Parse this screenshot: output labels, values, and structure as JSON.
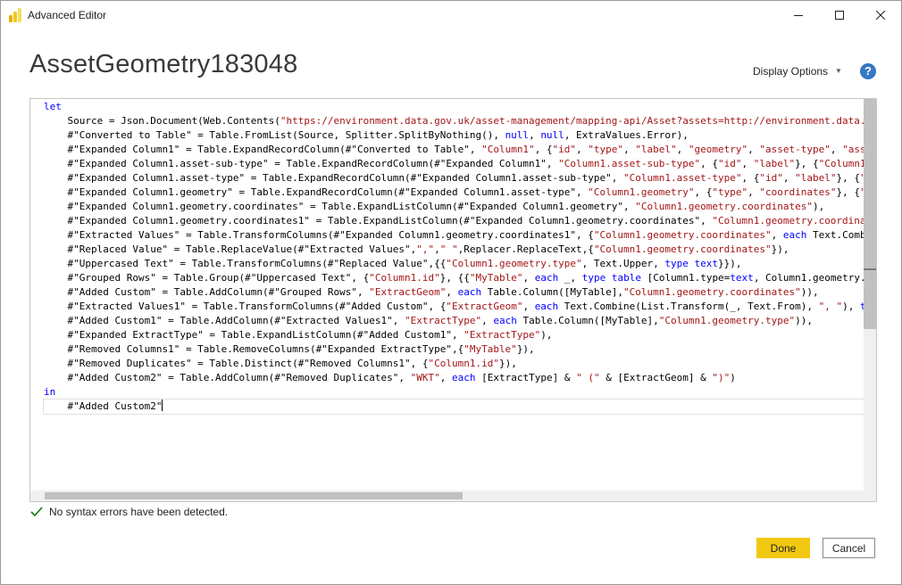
{
  "window": {
    "title": "Advanced Editor",
    "minimize_label": "minimize",
    "maximize_label": "maximize",
    "close_label": "close"
  },
  "header": {
    "query_name": "AssetGeometry183048",
    "display_options_label": "Display Options",
    "help_label": "?"
  },
  "editor": {
    "lines": [
      [
        {
          "t": "let",
          "c": "kw"
        }
      ],
      [
        {
          "t": "    Source = Json.Document(Web.Contents("
        },
        {
          "t": "\"https://environment.data.gov.uk/asset-management/mapping-api/Asset?assets=http://environment.data.gov",
          "c": "str"
        }
      ],
      [
        {
          "t": "    #\"Converted to Table\" = Table.FromList(Source, Splitter.SplitByNothing(), "
        },
        {
          "t": "null",
          "c": "kw"
        },
        {
          "t": ", "
        },
        {
          "t": "null",
          "c": "kw"
        },
        {
          "t": ", ExtraValues.Error),"
        }
      ],
      [
        {
          "t": "    #\"Expanded Column1\" = Table.ExpandRecordColumn(#\"Converted to Table\", "
        },
        {
          "t": "\"Column1\"",
          "c": "str"
        },
        {
          "t": ", {"
        },
        {
          "t": "\"id\"",
          "c": "str"
        },
        {
          "t": ", "
        },
        {
          "t": "\"type\"",
          "c": "str"
        },
        {
          "t": ", "
        },
        {
          "t": "\"label\"",
          "c": "str"
        },
        {
          "t": ", "
        },
        {
          "t": "\"geometry\"",
          "c": "str"
        },
        {
          "t": ", "
        },
        {
          "t": "\"asset-type\"",
          "c": "str"
        },
        {
          "t": ", "
        },
        {
          "t": "\"asset",
          "c": "str"
        }
      ],
      [
        {
          "t": "    #\"Expanded Column1.asset-sub-type\" = Table.ExpandRecordColumn(#\"Expanded Column1\", "
        },
        {
          "t": "\"Column1.asset-sub-type\"",
          "c": "str"
        },
        {
          "t": ", {"
        },
        {
          "t": "\"id\"",
          "c": "str"
        },
        {
          "t": ", "
        },
        {
          "t": "\"label\"",
          "c": "str"
        },
        {
          "t": "}, {"
        },
        {
          "t": "\"Column1.as",
          "c": "str"
        }
      ],
      [
        {
          "t": "    #\"Expanded Column1.asset-type\" = Table.ExpandRecordColumn(#\"Expanded Column1.asset-sub-type\", "
        },
        {
          "t": "\"Column1.asset-type\"",
          "c": "str"
        },
        {
          "t": ", {"
        },
        {
          "t": "\"id\"",
          "c": "str"
        },
        {
          "t": ", "
        },
        {
          "t": "\"label\"",
          "c": "str"
        },
        {
          "t": "}, {"
        },
        {
          "t": "\"Co",
          "c": "str"
        }
      ],
      [
        {
          "t": "    #\"Expanded Column1.geometry\" = Table.ExpandRecordColumn(#\"Expanded Column1.asset-type\", "
        },
        {
          "t": "\"Column1.geometry\"",
          "c": "str"
        },
        {
          "t": ", {"
        },
        {
          "t": "\"type\"",
          "c": "str"
        },
        {
          "t": ", "
        },
        {
          "t": "\"coordinates\"",
          "c": "str"
        },
        {
          "t": "}, {"
        },
        {
          "t": "\"Co",
          "c": "str"
        }
      ],
      [
        {
          "t": "    #\"Expanded Column1.geometry.coordinates\" = Table.ExpandListColumn(#\"Expanded Column1.geometry\", "
        },
        {
          "t": "\"Column1.geometry.coordinates\"",
          "c": "str"
        },
        {
          "t": "),"
        }
      ],
      [
        {
          "t": "    #\"Expanded Column1.geometry.coordinates1\" = Table.ExpandListColumn(#\"Expanded Column1.geometry.coordinates\", "
        },
        {
          "t": "\"Column1.geometry.coordinate",
          "c": "str"
        }
      ],
      [
        {
          "t": "    #\"Extracted Values\" = Table.TransformColumns(#\"Expanded Column1.geometry.coordinates1\", {"
        },
        {
          "t": "\"Column1.geometry.coordinates\"",
          "c": "str"
        },
        {
          "t": ", "
        },
        {
          "t": "each",
          "c": "kw"
        },
        {
          "t": " Text.Combine"
        }
      ],
      [
        {
          "t": "    #\"Replaced Value\" = Table.ReplaceValue(#\"Extracted Values\","
        },
        {
          "t": "\",\"",
          "c": "str"
        },
        {
          "t": ","
        },
        {
          "t": "\" \"",
          "c": "str"
        },
        {
          "t": ",Replacer.ReplaceText,{"
        },
        {
          "t": "\"Column1.geometry.coordinates\"",
          "c": "str"
        },
        {
          "t": "}),"
        }
      ],
      [
        {
          "t": "    #\"Uppercased Text\" = Table.TransformColumns(#\"Replaced Value\",{{"
        },
        {
          "t": "\"Column1.geometry.type\"",
          "c": "str"
        },
        {
          "t": ", Text.Upper, "
        },
        {
          "t": "type",
          "c": "kw"
        },
        {
          "t": " "
        },
        {
          "t": "text",
          "c": "kw"
        },
        {
          "t": "}}),"
        }
      ],
      [
        {
          "t": "    #\"Grouped Rows\" = Table.Group(#\"Uppercased Text\", {"
        },
        {
          "t": "\"Column1.id\"",
          "c": "str"
        },
        {
          "t": "}, {{"
        },
        {
          "t": "\"MyTable\"",
          "c": "str"
        },
        {
          "t": ", "
        },
        {
          "t": "each",
          "c": "kw"
        },
        {
          "t": " _, "
        },
        {
          "t": "type",
          "c": "kw"
        },
        {
          "t": " "
        },
        {
          "t": "table",
          "c": "kw"
        },
        {
          "t": " [Column1.type="
        },
        {
          "t": "text",
          "c": "kw"
        },
        {
          "t": ", Column1.geometry.ty"
        }
      ],
      [
        {
          "t": "    #\"Added Custom\" = Table.AddColumn(#\"Grouped Rows\", "
        },
        {
          "t": "\"ExtractGeom\"",
          "c": "str"
        },
        {
          "t": ", "
        },
        {
          "t": "each",
          "c": "kw"
        },
        {
          "t": " Table.Column([MyTable],"
        },
        {
          "t": "\"Column1.geometry.coordinates\"",
          "c": "str"
        },
        {
          "t": ")),"
        }
      ],
      [
        {
          "t": "    #\"Extracted Values1\" = Table.TransformColumns(#\"Added Custom\", {"
        },
        {
          "t": "\"ExtractGeom\"",
          "c": "str"
        },
        {
          "t": ", "
        },
        {
          "t": "each",
          "c": "kw"
        },
        {
          "t": " Text.Combine(List.Transform(_, Text.From), "
        },
        {
          "t": "\", \"",
          "c": "str"
        },
        {
          "t": "), "
        },
        {
          "t": "type",
          "c": "kw"
        }
      ],
      [
        {
          "t": "    #\"Added Custom1\" = Table.AddColumn(#\"Extracted Values1\", "
        },
        {
          "t": "\"ExtractType\"",
          "c": "str"
        },
        {
          "t": ", "
        },
        {
          "t": "each",
          "c": "kw"
        },
        {
          "t": " Table.Column([MyTable],"
        },
        {
          "t": "\"Column1.geometry.type\"",
          "c": "str"
        },
        {
          "t": ")),"
        }
      ],
      [
        {
          "t": "    #\"Expanded ExtractType\" = Table.ExpandListColumn(#\"Added Custom1\", "
        },
        {
          "t": "\"ExtractType\"",
          "c": "str"
        },
        {
          "t": "),"
        }
      ],
      [
        {
          "t": "    #\"Removed Columns1\" = Table.RemoveColumns(#\"Expanded ExtractType\",{"
        },
        {
          "t": "\"MyTable\"",
          "c": "str"
        },
        {
          "t": "}),"
        }
      ],
      [
        {
          "t": "    #\"Removed Duplicates\" = Table.Distinct(#\"Removed Columns1\", {"
        },
        {
          "t": "\"Column1.id\"",
          "c": "str"
        },
        {
          "t": "}),"
        }
      ],
      [
        {
          "t": "    #\"Added Custom2\" = Table.AddColumn(#\"Removed Duplicates\", "
        },
        {
          "t": "\"WKT\"",
          "c": "str"
        },
        {
          "t": ", "
        },
        {
          "t": "each",
          "c": "kw"
        },
        {
          "t": " [ExtractType] & "
        },
        {
          "t": "\" (\"",
          "c": "str"
        },
        {
          "t": " & [ExtractGeom] & "
        },
        {
          "t": "\")\"",
          "c": "str"
        },
        {
          "t": ")"
        }
      ],
      [
        {
          "t": "in",
          "c": "kw"
        }
      ],
      [
        {
          "t": "    #\"Added Custom2\""
        }
      ]
    ]
  },
  "status": {
    "message": "No syntax errors have been detected."
  },
  "footer": {
    "done_label": "Done",
    "cancel_label": "Cancel"
  },
  "colors": {
    "accent_done": "#f2c811",
    "keyword": "#0000ff",
    "string": "#a31515",
    "success_check": "#107c10",
    "help_icon": "#3478c6"
  }
}
